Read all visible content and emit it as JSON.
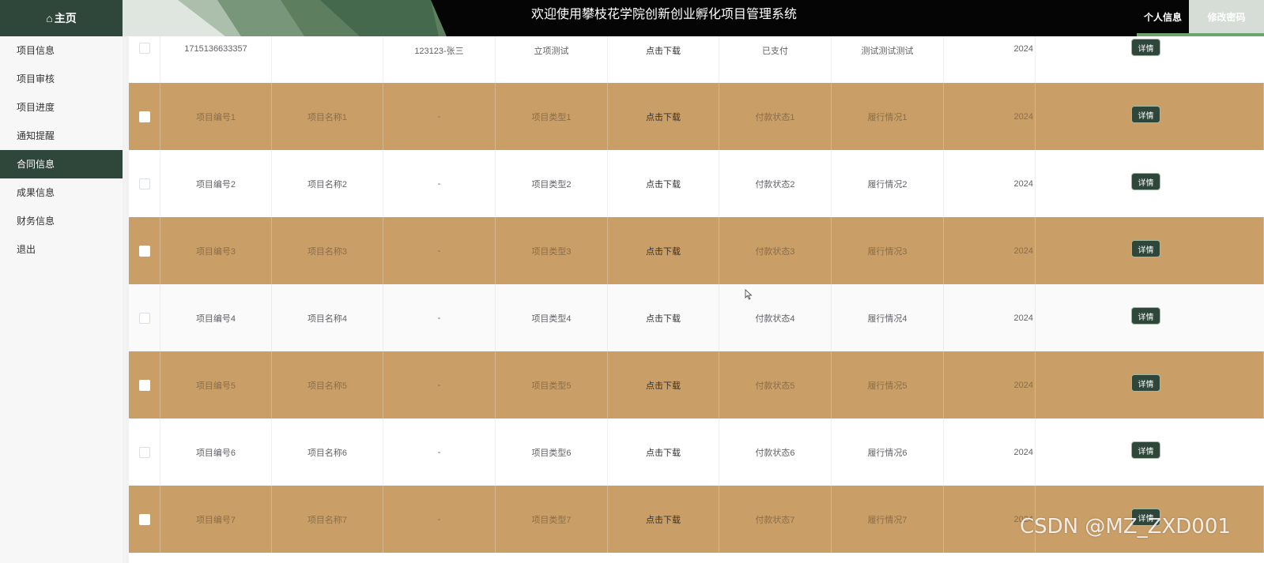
{
  "header": {
    "home_label": "主页",
    "title": "欢迎使用攀枝花学院创新创业孵化项目管理系统",
    "personal_label": "个人信息",
    "change_password_label": "修改密码"
  },
  "sidebar": {
    "items": [
      {
        "label": "项目信息"
      },
      {
        "label": "项目审核"
      },
      {
        "label": "项目进度"
      },
      {
        "label": "通知提醒"
      },
      {
        "label": "合同信息"
      },
      {
        "label": "成果信息"
      },
      {
        "label": "财务信息"
      },
      {
        "label": "退出"
      }
    ]
  },
  "table": {
    "detail_label": "详情",
    "rows": [
      {
        "no": "1715136633357",
        "name": "",
        "applicant": "123123-张三",
        "type": "立项测试",
        "download": "点击下载",
        "pay": "已支付",
        "perform": "测试测试测试",
        "date": "2024"
      },
      {
        "no": "项目编号1",
        "name": "项目名称1",
        "applicant": "-",
        "type": "项目类型1",
        "download": "点击下载",
        "pay": "付款状态1",
        "perform": "履行情况1",
        "date": "2024"
      },
      {
        "no": "项目编号2",
        "name": "项目名称2",
        "applicant": "-",
        "type": "项目类型2",
        "download": "点击下载",
        "pay": "付款状态2",
        "perform": "履行情况2",
        "date": "2024"
      },
      {
        "no": "项目编号3",
        "name": "项目名称3",
        "applicant": "-",
        "type": "项目类型3",
        "download": "点击下载",
        "pay": "付款状态3",
        "perform": "履行情况3",
        "date": "2024"
      },
      {
        "no": "项目编号4",
        "name": "项目名称4",
        "applicant": "-",
        "type": "项目类型4",
        "download": "点击下载",
        "pay": "付款状态4",
        "perform": "履行情况4",
        "date": "2024"
      },
      {
        "no": "项目编号5",
        "name": "项目名称5",
        "applicant": "-",
        "type": "项目类型5",
        "download": "点击下载",
        "pay": "付款状态5",
        "perform": "履行情况5",
        "date": "2024"
      },
      {
        "no": "项目编号6",
        "name": "项目名称6",
        "applicant": "-",
        "type": "项目类型6",
        "download": "点击下载",
        "pay": "付款状态6",
        "perform": "履行情况6",
        "date": "2024"
      },
      {
        "no": "项目编号7",
        "name": "项目名称7",
        "applicant": "-",
        "type": "项目类型7",
        "download": "点击下载",
        "pay": "付款状态7",
        "perform": "履行情况7",
        "date": "2024"
      }
    ]
  },
  "watermark": "CSDN @MZ_ZXD001",
  "colors": {
    "accent_dark_green": "#2f463b",
    "row_highlight": "#c99e67",
    "tab_underline": "#6aa56e"
  }
}
